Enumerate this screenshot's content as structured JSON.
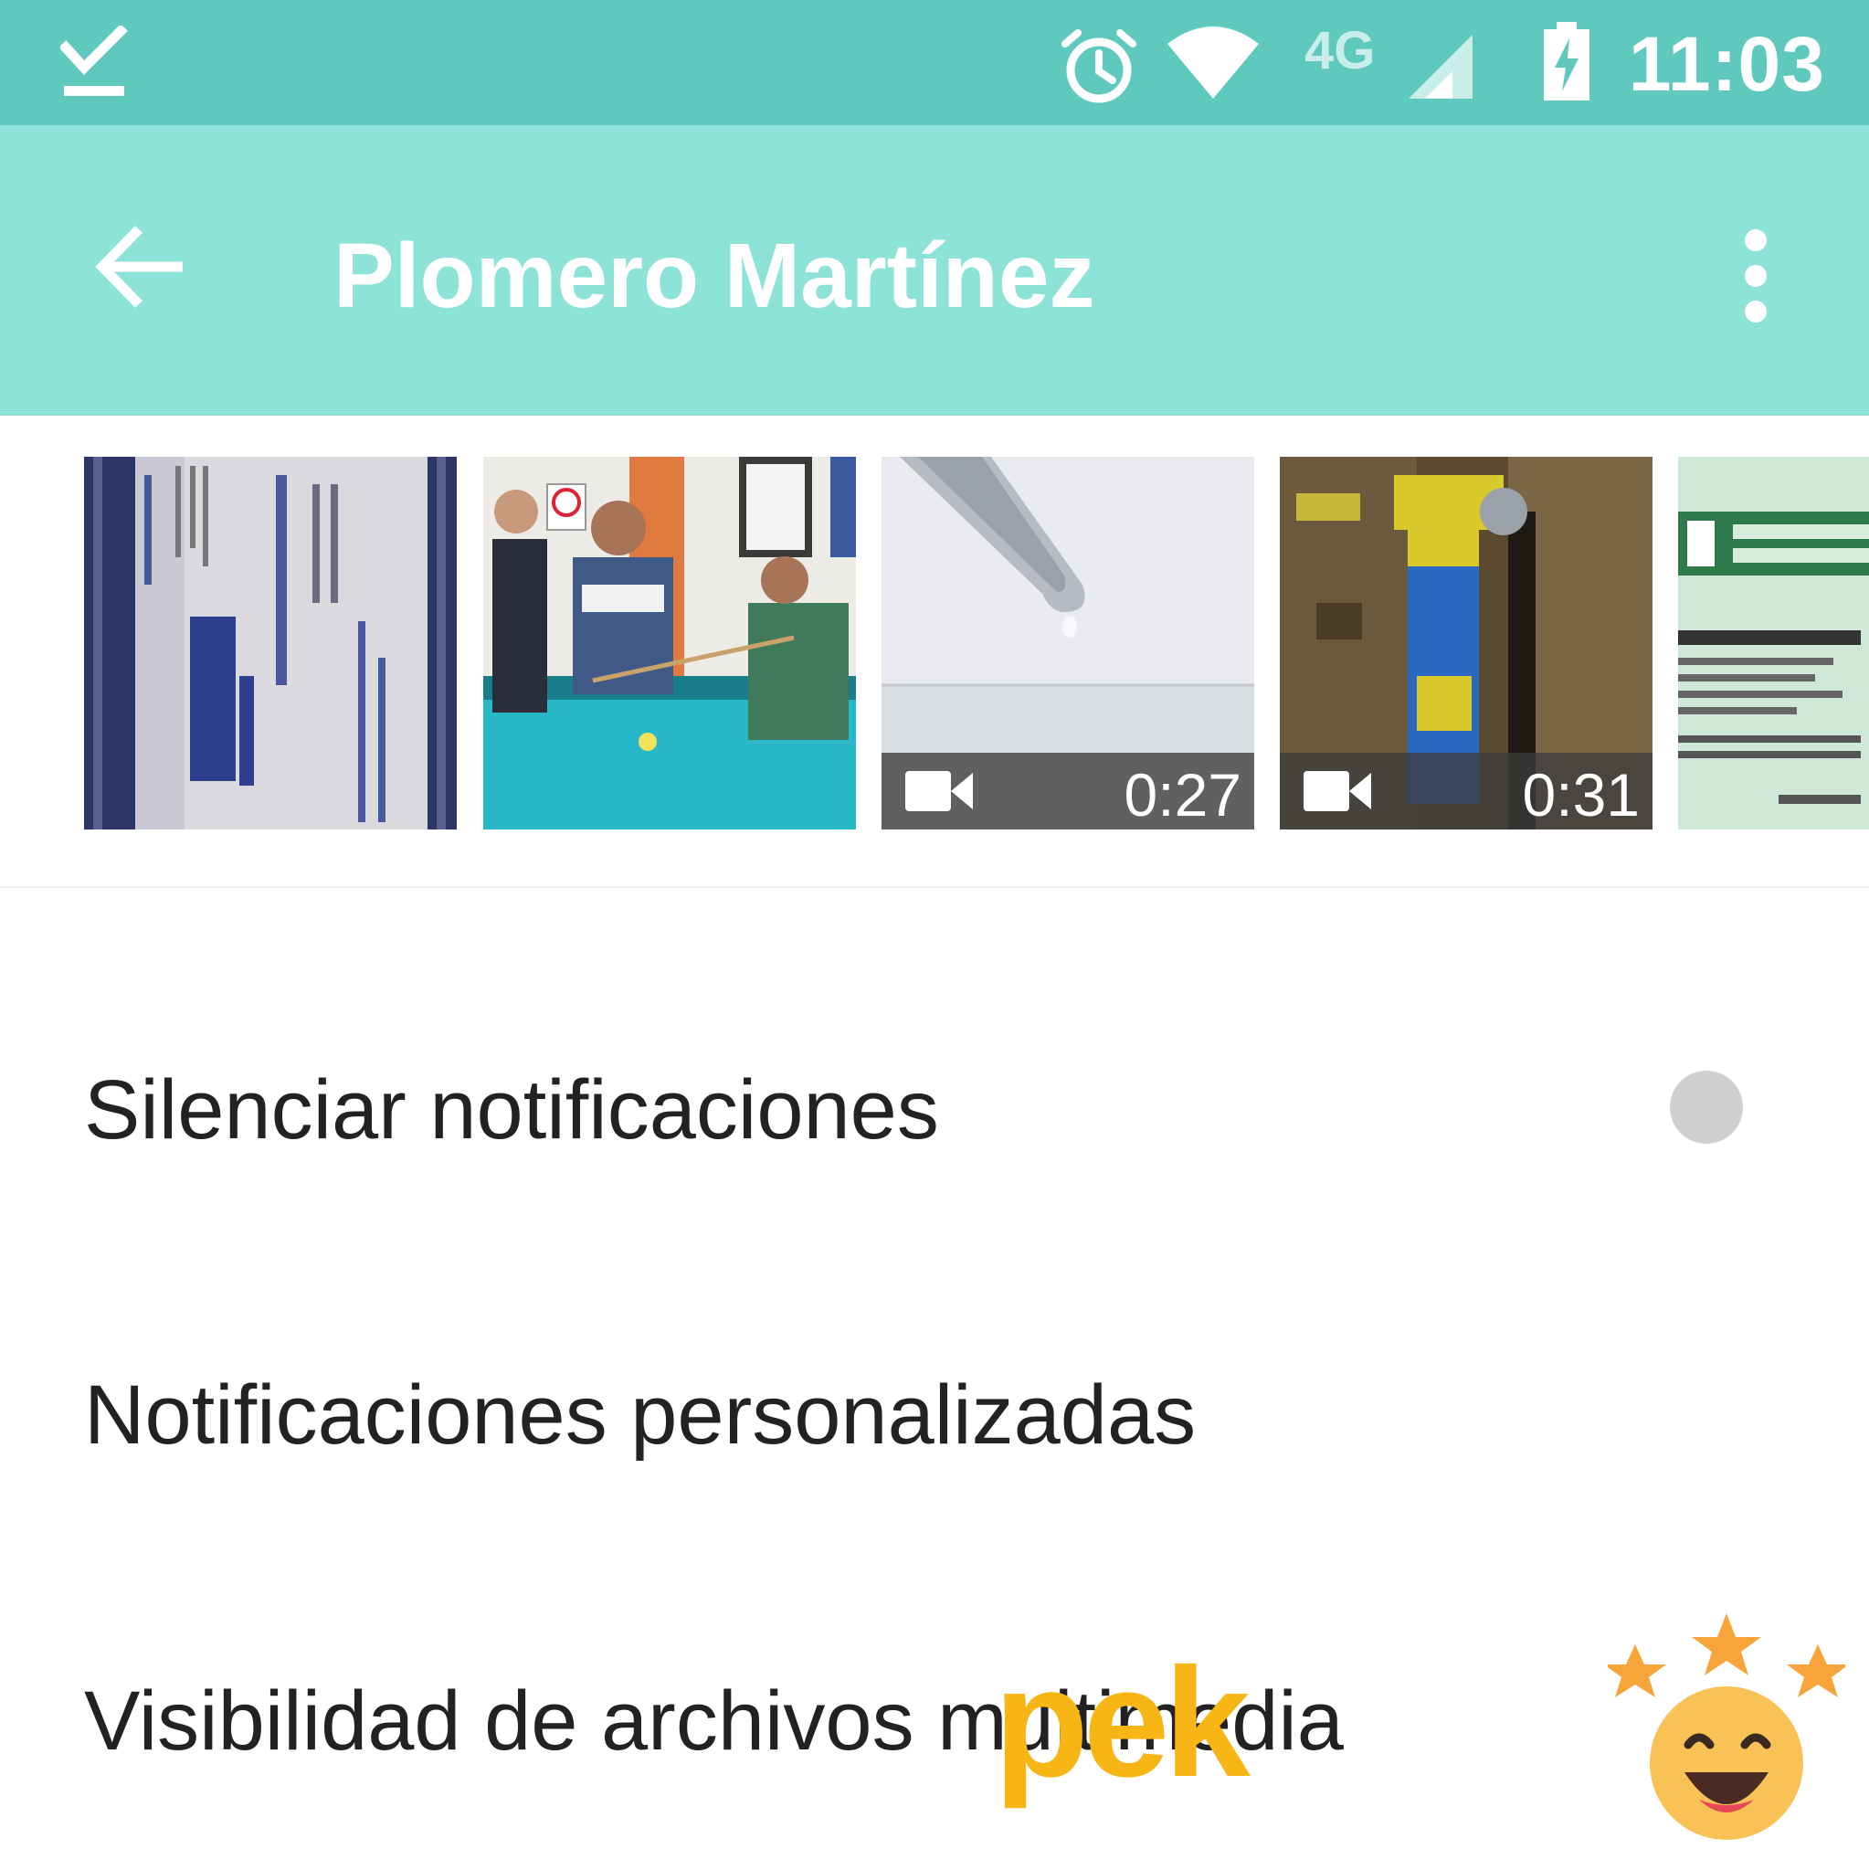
{
  "status_bar": {
    "time": "11:03",
    "network_label": "4G",
    "icons": [
      "download-done-icon",
      "alarm-icon",
      "wifi-icon",
      "signal-icon",
      "battery-charging-icon"
    ]
  },
  "app_bar": {
    "title": "Plomero Martínez",
    "back_icon": "arrow-back-icon",
    "menu_icon": "more-vert-icon"
  },
  "media": [
    {
      "kind": "image",
      "description": "business card"
    },
    {
      "kind": "image",
      "description": "pool hall"
    },
    {
      "kind": "video",
      "duration": "0:27"
    },
    {
      "kind": "video",
      "duration": "0:31"
    },
    {
      "kind": "image",
      "description": "utility receipt"
    }
  ],
  "settings": {
    "mute": {
      "label": "Silenciar notificaciones",
      "enabled": false
    },
    "custom": {
      "label": "Notificaciones personalizadas"
    },
    "media_visibility": {
      "label": "Visibilidad de archivos multimedia"
    }
  },
  "watermark": {
    "text": "pek"
  },
  "colors": {
    "status_bar": "#5fc9bd",
    "app_bar": "#8ee3d8",
    "accent": "#f7b615"
  }
}
